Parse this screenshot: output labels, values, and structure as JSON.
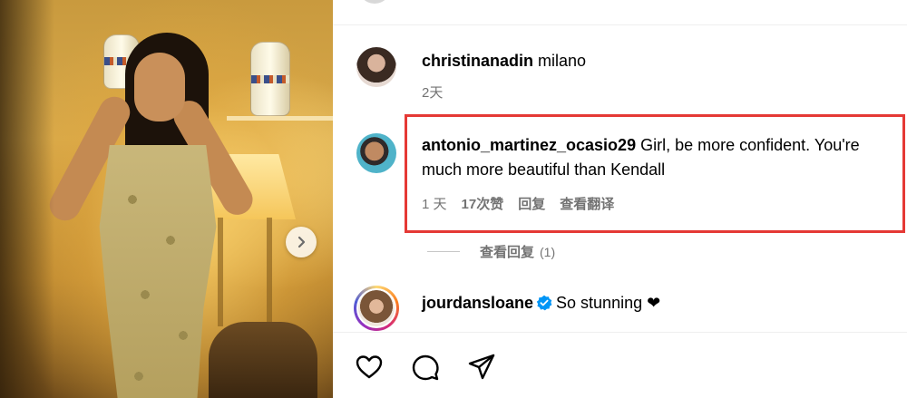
{
  "post": {
    "next_button_icon": "chevron-right-icon"
  },
  "comments": [
    {
      "username": "christinanadin",
      "text": "milano",
      "time": "2天"
    },
    {
      "username": "antonio_martinez_ocasio29",
      "text": "Girl, be more confident. You're much more beautiful than Kendall",
      "time": "1 天",
      "likes": "17次赞",
      "reply_label": "回复",
      "translate_label": "查看翻译",
      "view_replies_label": "查看回复",
      "view_replies_count": "(1)"
    },
    {
      "username": "jourdansloane",
      "text": "So stunning ❤",
      "verified": true
    }
  ],
  "colors": {
    "highlight": "#e53935",
    "meta_text": "#737373",
    "verified_blue": "#0095f6"
  },
  "actions": {
    "icons": [
      "heart-icon",
      "comment-icon",
      "share-icon"
    ]
  }
}
